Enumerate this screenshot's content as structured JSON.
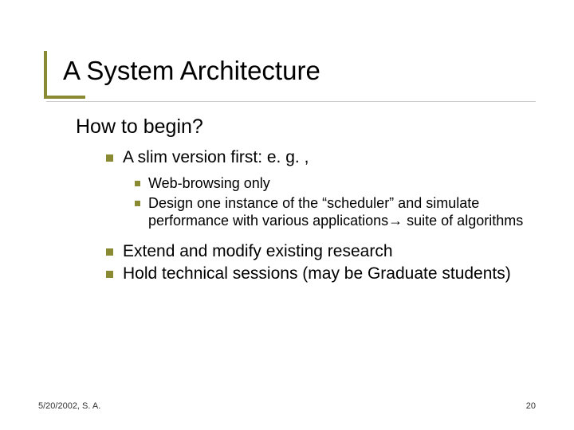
{
  "title": "A System Architecture",
  "lvl1": {
    "text": "How to begin?"
  },
  "lvl2": [
    {
      "text": "A slim version first: e. g. ,"
    }
  ],
  "lvl3": [
    {
      "text": "Web-browsing only"
    },
    {
      "text": "Design one instance of the “scheduler” and simulate performance with various applications→ suite of algorithms"
    }
  ],
  "lvl2b": [
    {
      "text": "Extend and modify existing research"
    },
    {
      "text": "Hold technical sessions (may be Graduate students)"
    }
  ],
  "footer": {
    "left": "5/20/2002, S. A.",
    "right": "20"
  }
}
